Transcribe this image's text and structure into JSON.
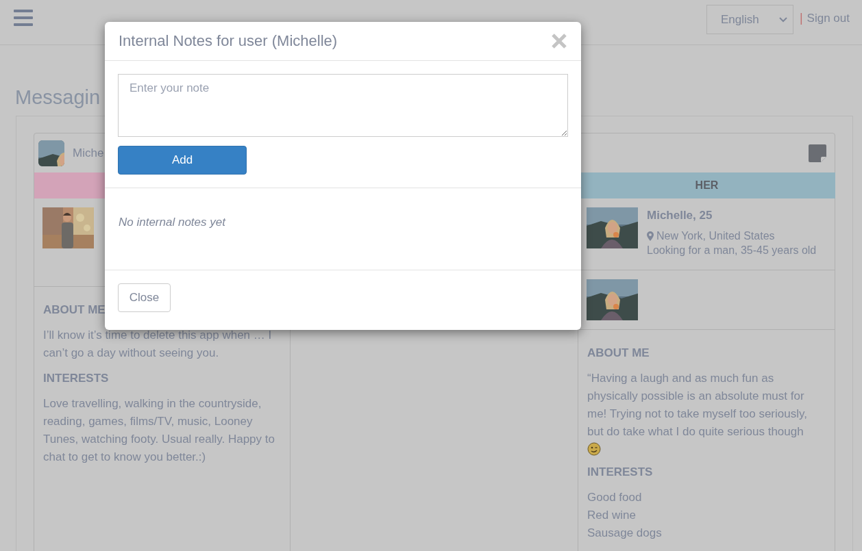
{
  "top_bar": {
    "language_select": {
      "value": "English"
    },
    "separator": "|",
    "sign_out": "Sign out"
  },
  "page": {
    "title": "Messagin"
  },
  "conversation": {
    "user_name": "Miche",
    "columns": [
      {
        "kind": "profile",
        "color": "#d3a3b8",
        "about_heading": "ABOUT ME",
        "about": "I’ll know it’s time to delete this app when … I can’t go a day without seeing you.",
        "interests_heading": "INTERESTS",
        "interests": [
          "Love travelling, walking in the countryside, reading, games, films/TV, music, Looney Tunes, watching footy. Usual really. Happy to chat to get to know you better.:)"
        ]
      },
      {
        "kind": "empty"
      },
      {
        "kind": "profile",
        "header": "HER",
        "color": "#93b3bf",
        "name": "Michelle, 25",
        "location": "New York, United States",
        "looking_for": "Looking for a man, 35-45 years old",
        "about_heading": "ABOUT ME",
        "about": "“Having a laugh and as much fun as physically possible is an absolute must for me! Trying not to take myself too seriously, but do take what I do quite serious though",
        "about_emoji": true,
        "interests_heading": "INTERESTS",
        "interests": [
          "Good food",
          "Red wine",
          "Sausage dogs"
        ]
      }
    ]
  },
  "modal": {
    "title": "Internal Notes for user (Michelle)",
    "note_field": {
      "placeholder": "Enter your note"
    },
    "add_button": "Add",
    "empty_message": "No internal notes yet",
    "close_button": "Close"
  }
}
